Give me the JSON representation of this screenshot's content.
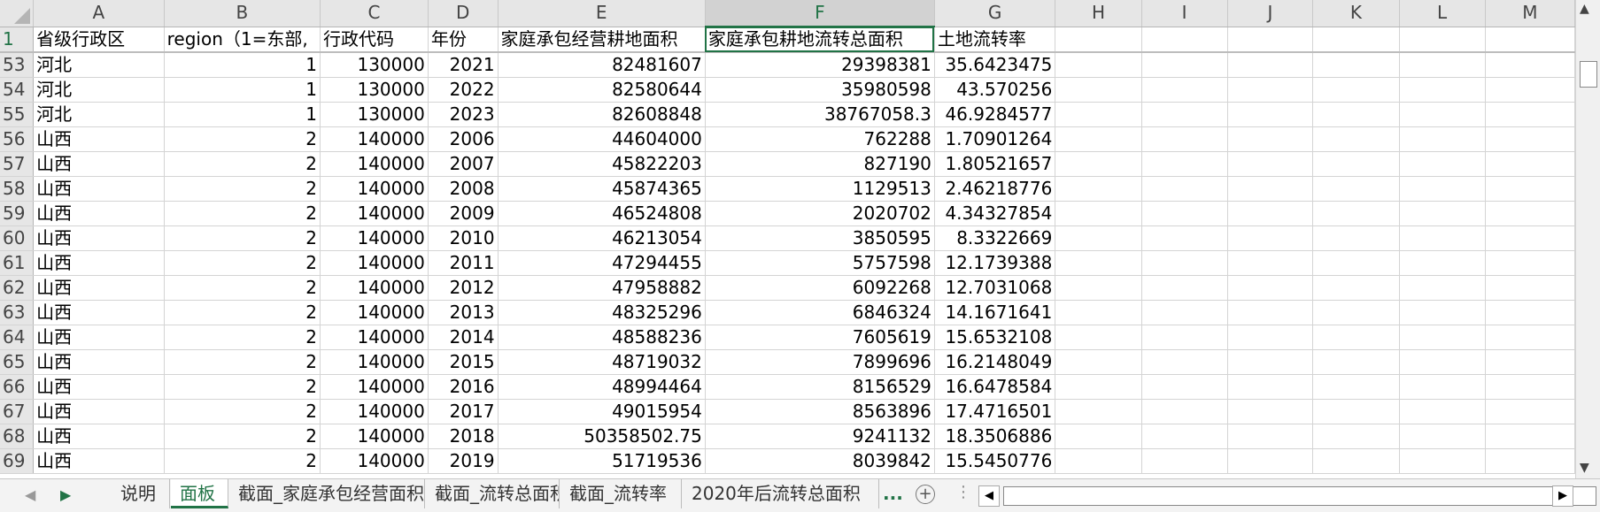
{
  "columns": [
    "A",
    "B",
    "C",
    "D",
    "E",
    "F",
    "G",
    "H",
    "I",
    "J",
    "K",
    "L",
    "M"
  ],
  "header_row": {
    "row": "1",
    "A": "省级行政区",
    "B": "region（1=东部,",
    "C": "行政代码",
    "D": "年份",
    "E": "家庭承包经营耕地面积",
    "F": "家庭承包耕地流转总面积",
    "G": "土地流转率"
  },
  "rows": [
    {
      "row": "53",
      "A": "河北",
      "B": "1",
      "C": "130000",
      "D": "2021",
      "E": "82481607",
      "F": "29398381",
      "G": "35.6423475"
    },
    {
      "row": "54",
      "A": "河北",
      "B": "1",
      "C": "130000",
      "D": "2022",
      "E": "82580644",
      "F": "35980598",
      "G": "43.570256"
    },
    {
      "row": "55",
      "A": "河北",
      "B": "1",
      "C": "130000",
      "D": "2023",
      "E": "82608848",
      "F": "38767058.3",
      "G": "46.9284577"
    },
    {
      "row": "56",
      "A": "山西",
      "B": "2",
      "C": "140000",
      "D": "2006",
      "E": "44604000",
      "F": "762288",
      "G": "1.70901264"
    },
    {
      "row": "57",
      "A": "山西",
      "B": "2",
      "C": "140000",
      "D": "2007",
      "E": "45822203",
      "F": "827190",
      "G": "1.80521657"
    },
    {
      "row": "58",
      "A": "山西",
      "B": "2",
      "C": "140000",
      "D": "2008",
      "E": "45874365",
      "F": "1129513",
      "G": "2.46218776"
    },
    {
      "row": "59",
      "A": "山西",
      "B": "2",
      "C": "140000",
      "D": "2009",
      "E": "46524808",
      "F": "2020702",
      "G": "4.34327854"
    },
    {
      "row": "60",
      "A": "山西",
      "B": "2",
      "C": "140000",
      "D": "2010",
      "E": "46213054",
      "F": "3850595",
      "G": "8.3322669"
    },
    {
      "row": "61",
      "A": "山西",
      "B": "2",
      "C": "140000",
      "D": "2011",
      "E": "47294455",
      "F": "5757598",
      "G": "12.1739388"
    },
    {
      "row": "62",
      "A": "山西",
      "B": "2",
      "C": "140000",
      "D": "2012",
      "E": "47958882",
      "F": "6092268",
      "G": "12.7031068"
    },
    {
      "row": "63",
      "A": "山西",
      "B": "2",
      "C": "140000",
      "D": "2013",
      "E": "48325296",
      "F": "6846324",
      "G": "14.1671641"
    },
    {
      "row": "64",
      "A": "山西",
      "B": "2",
      "C": "140000",
      "D": "2014",
      "E": "48588236",
      "F": "7605619",
      "G": "15.6532108"
    },
    {
      "row": "65",
      "A": "山西",
      "B": "2",
      "C": "140000",
      "D": "2015",
      "E": "48719032",
      "F": "7899696",
      "G": "16.2148049"
    },
    {
      "row": "66",
      "A": "山西",
      "B": "2",
      "C": "140000",
      "D": "2016",
      "E": "48994464",
      "F": "8156529",
      "G": "16.6478584"
    },
    {
      "row": "67",
      "A": "山西",
      "B": "2",
      "C": "140000",
      "D": "2017",
      "E": "49015954",
      "F": "8563896",
      "G": "17.4716501"
    },
    {
      "row": "68",
      "A": "山西",
      "B": "2",
      "C": "140000",
      "D": "2018",
      "E": "50358502.75",
      "F": "9241132",
      "G": "18.3506886"
    },
    {
      "row": "69",
      "A": "山西",
      "B": "2",
      "C": "140000",
      "D": "2019",
      "E": "51719536",
      "F": "8039842",
      "G": "15.5450776"
    }
  ],
  "selected_column": "F",
  "sheet_tabs": [
    {
      "label": "说明",
      "active": false
    },
    {
      "label": "面板",
      "active": true
    },
    {
      "label": "截面_家庭承包经营面积",
      "active": false
    },
    {
      "label": "截面_流转总面积",
      "active": false
    },
    {
      "label": "截面_流转率",
      "active": false
    },
    {
      "label": "2020年后流转总面积",
      "active": false
    }
  ],
  "tabbar": {
    "prev_icon": "triangle-left",
    "next_icon": "triangle-right",
    "more_label": "...",
    "add_label": "+",
    "dots_label": "⋮"
  },
  "colors": {
    "accent": "#217346",
    "header_bg": "#e6e6e6",
    "gridline": "#d4d4d4"
  }
}
